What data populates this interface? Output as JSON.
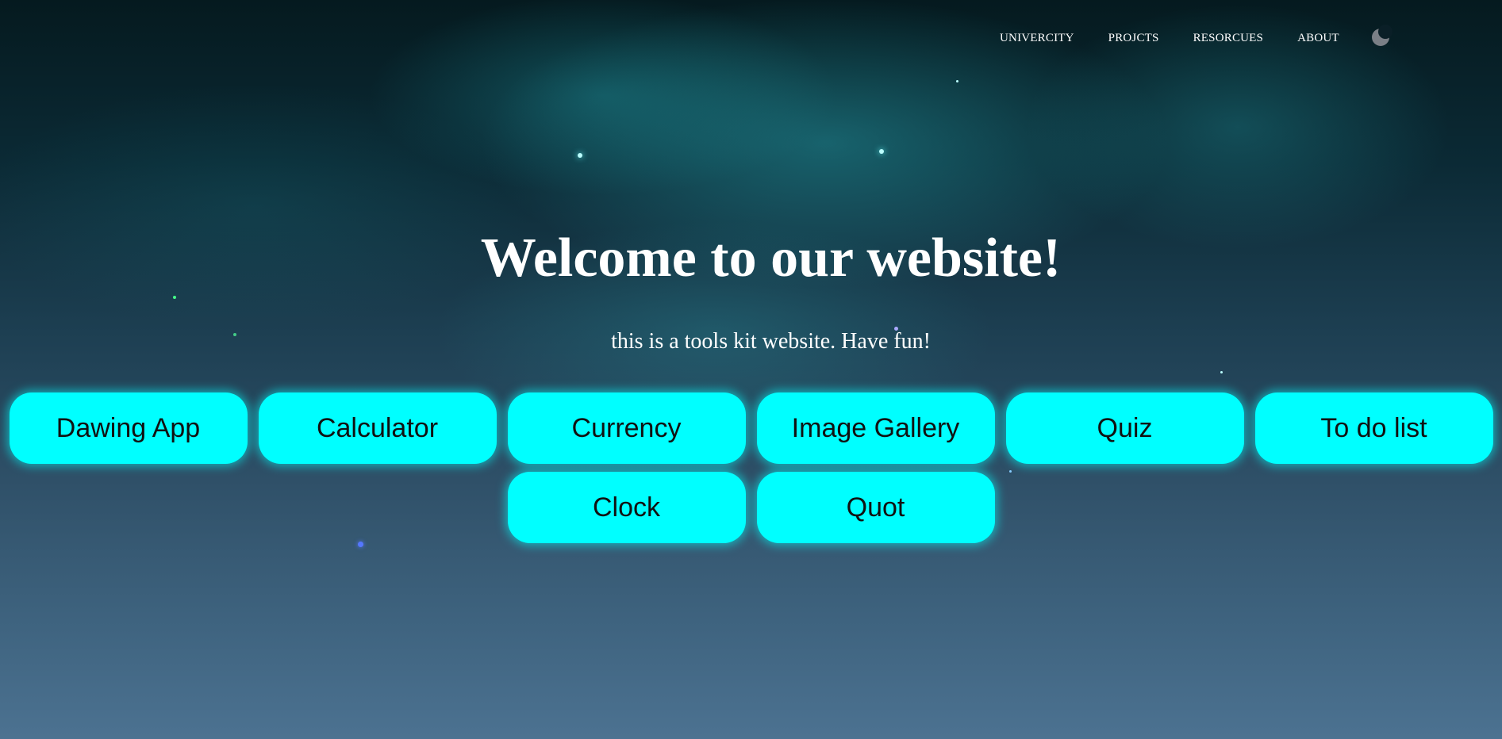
{
  "nav": {
    "items": [
      {
        "label": "UNIVERCITY"
      },
      {
        "label": "PROJCTS"
      },
      {
        "label": "RESORCUES"
      },
      {
        "label": "ABOUT"
      }
    ],
    "theme_toggle_icon": "moon-icon"
  },
  "hero": {
    "title": "Welcome to our website!",
    "subtitle": "this is a tools kit website. Have fun!"
  },
  "tools": [
    {
      "label": "Dawing App"
    },
    {
      "label": "Calculator"
    },
    {
      "label": "Currency"
    },
    {
      "label": "Image Gallery"
    },
    {
      "label": "Quiz"
    },
    {
      "label": "To do list"
    },
    {
      "label": "Clock"
    },
    {
      "label": "Quot"
    }
  ],
  "colors": {
    "button_bg": "#00ffff",
    "text_primary": "#ffffff"
  }
}
